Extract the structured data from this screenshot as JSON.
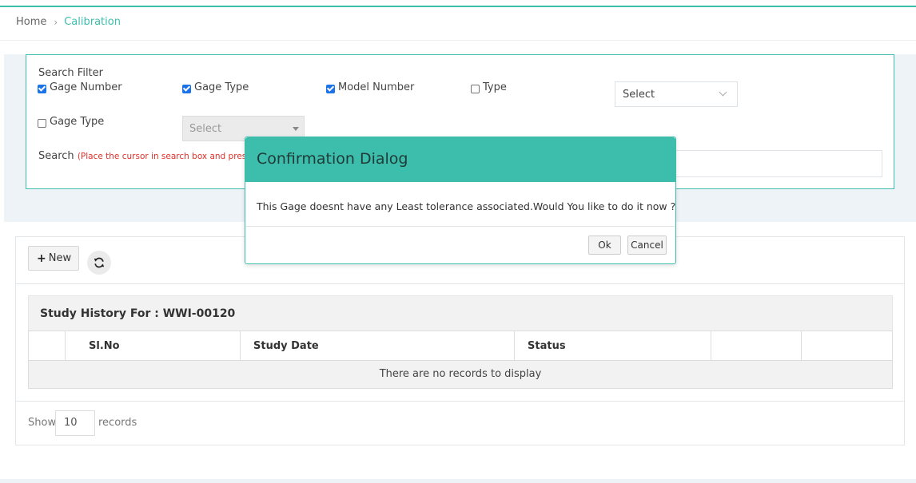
{
  "breadcrumb": {
    "home": "Home",
    "separator": "›",
    "current": "Calibration"
  },
  "filter": {
    "title": "Search Filter",
    "options": [
      {
        "label": "Gage Number",
        "checked": true
      },
      {
        "label": "Gage Type",
        "checked": true
      },
      {
        "label": "Model Number",
        "checked": true
      },
      {
        "label": "Type",
        "checked": false
      },
      {
        "label": "Gage Type",
        "checked": false
      }
    ],
    "type_select": "Select",
    "gage_type_select": "Select",
    "search_label": "Search",
    "search_hint": "(Place the cursor in search box and press t",
    "search_value": ""
  },
  "toolbar": {
    "new_label": "New"
  },
  "study": {
    "header": "Study History For : WWI-00120",
    "columns": [
      "",
      "Sl.No",
      "Study Date",
      "Status",
      "",
      ""
    ],
    "empty_message": "There are no records to display"
  },
  "pagination": {
    "show_label": "Show",
    "page_size": "10",
    "records_label": "records"
  },
  "dialog": {
    "title": "Confirmation Dialog",
    "message": "This Gage doesnt have any Least tolerance associated.Would You like to do it now ?",
    "ok_label": "Ok",
    "cancel_label": "Cancel"
  },
  "colors": {
    "accent": "#3dbdac",
    "checkbox": "#1a73e8",
    "hint": "#e0302b"
  }
}
